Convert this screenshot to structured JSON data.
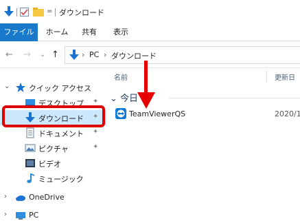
{
  "titlebar": {
    "dropdown_glyph": "=",
    "title": "ダウンロード"
  },
  "ribbon": {
    "tabs": [
      "ファイル",
      "ホーム",
      "共有",
      "表示"
    ]
  },
  "address": {
    "back_glyph": "←",
    "forward_glyph": "→",
    "recent_glyph": "⌄",
    "up_glyph": "↑",
    "sep": "›",
    "crumbs": [
      "PC",
      "ダウンロード"
    ]
  },
  "navpane": {
    "quick_access": "クイック アクセス",
    "items": [
      {
        "label": "デスクトップ",
        "pinned": true
      },
      {
        "label": "ダウンロード",
        "pinned": true
      },
      {
        "label": "ドキュメント",
        "pinned": true
      },
      {
        "label": "ピクチャ",
        "pinned": true
      },
      {
        "label": "ビデオ",
        "pinned": false
      },
      {
        "label": "ミュージック",
        "pinned": false
      }
    ],
    "onedrive": "OneDrive",
    "pc": "PC"
  },
  "filelist": {
    "columns": {
      "name": "名前",
      "date": "更新日"
    },
    "group": "今日 (",
    "files": [
      {
        "name": "TeamViewerQS",
        "date": "2020/1"
      }
    ]
  },
  "colors": {
    "accent": "#1979ca",
    "highlight": "#e00000",
    "selected": "#cce8ff"
  }
}
